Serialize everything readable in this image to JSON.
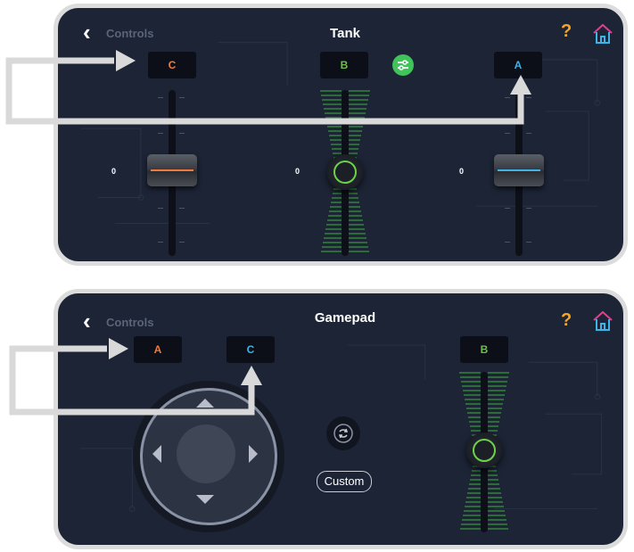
{
  "tank": {
    "nav_label": "Controls",
    "title": "Tank",
    "ports": {
      "left": "C",
      "center": "B",
      "right": "A"
    },
    "left_slider_value": "0",
    "center_slider_value": "0",
    "right_slider_value": "0",
    "colors": {
      "left_stripe": "#f07a3c",
      "right_stripe": "#3fb2e6",
      "knob": "#6cd24a"
    }
  },
  "gamepad": {
    "nav_label": "Controls",
    "title": "Gamepad",
    "ports": {
      "first": "A",
      "second": "C",
      "right": "B"
    },
    "custom_label": "Custom"
  },
  "icons": {
    "back": "chevron-left-icon",
    "help": "question-mark-icon",
    "home": "home-icon",
    "settings": "sliders-icon",
    "swap": "swap-icon"
  }
}
